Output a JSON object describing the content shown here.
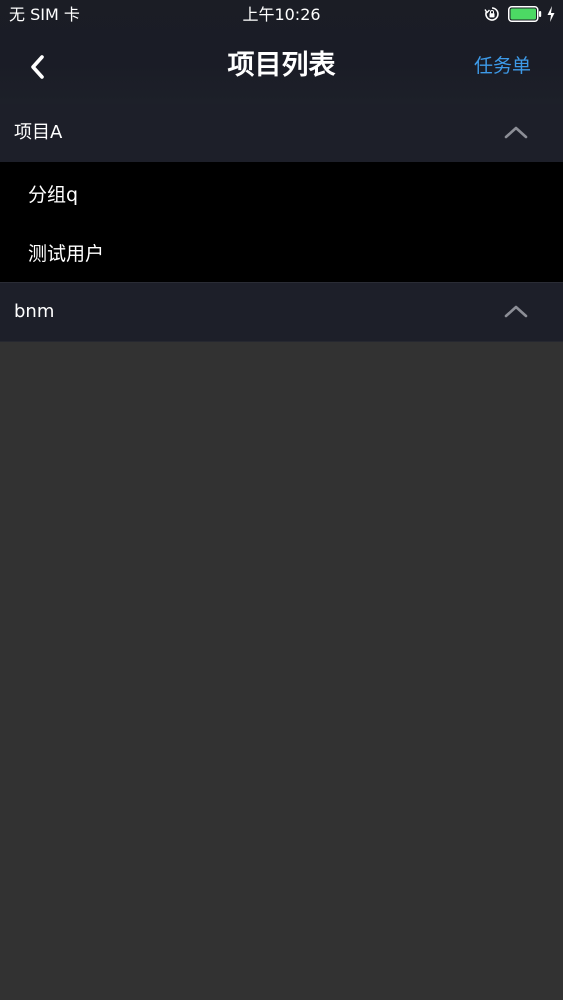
{
  "status_bar": {
    "carrier": "无 SIM 卡",
    "time": "上午10:26",
    "battery_fill_fraction": 1.0,
    "battery_color": "#4cd964",
    "icons": [
      "rotation-lock-icon",
      "battery-icon",
      "charging-bolt-icon"
    ]
  },
  "nav": {
    "back_icon": "chevron-left-icon",
    "title": "项目列表",
    "right_action": "任务单",
    "accent_color": "#3d9ae8"
  },
  "groups": [
    {
      "title": "项目A",
      "expanded": true,
      "toggle_icon": "chevron-up-icon",
      "items": [
        {
          "label": "分组q"
        },
        {
          "label": "测试用户"
        }
      ]
    },
    {
      "title": "bnm",
      "expanded": false,
      "toggle_icon": "chevron-up-icon",
      "items": []
    }
  ]
}
